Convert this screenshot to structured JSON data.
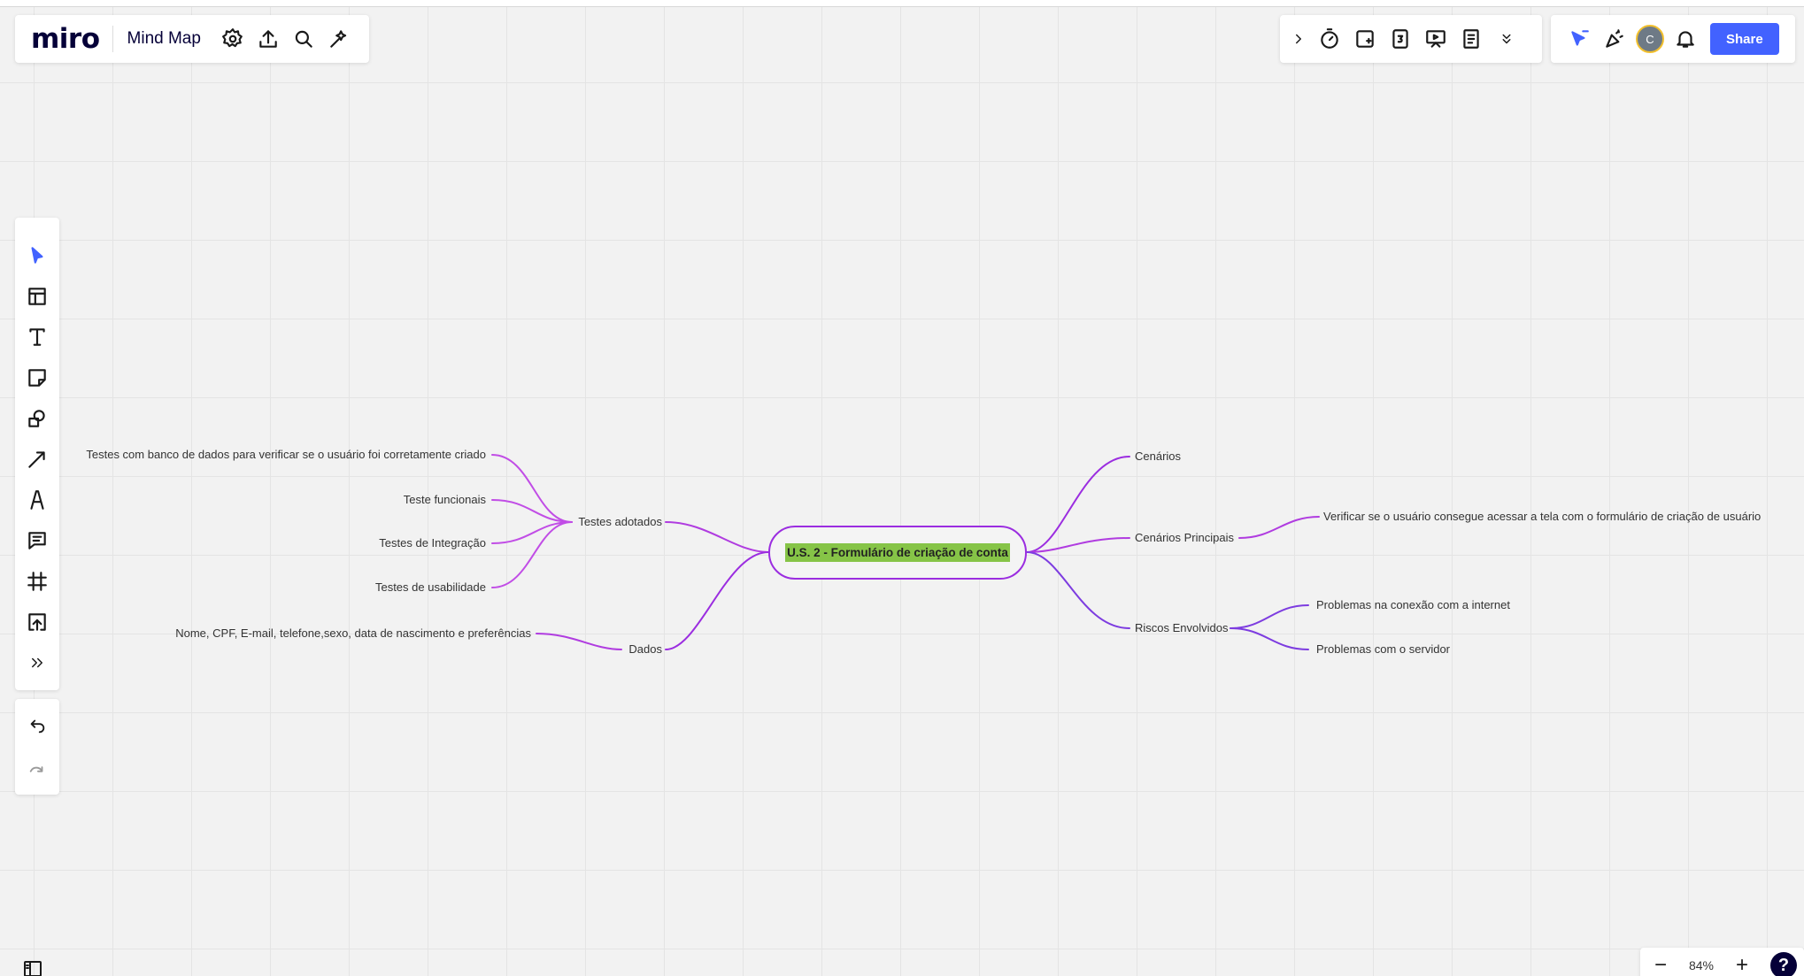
{
  "app": {
    "logo": "miro",
    "board_name": "Mind Map"
  },
  "header_right": {
    "share_label": "Share",
    "avatar_initial": "C"
  },
  "zoom": {
    "level": "84%",
    "minus": "−",
    "plus": "+",
    "help": "?"
  },
  "mind_map": {
    "root": "U.S. 2 - Formulário de criação de conta",
    "left": {
      "testes_adotados": {
        "label": "Testes adotados",
        "children": [
          "Testes com banco de dados para verificar se o usuário foi corretamente criado",
          "Teste funcionais",
          "Testes de Integração",
          "Testes de usabilidade"
        ]
      },
      "dados": {
        "label": "Dados",
        "children": [
          "Nome, CPF, E-mail, telefone,sexo, data de nascimento e preferências"
        ]
      }
    },
    "right": {
      "cenarios": {
        "label": "Cenários"
      },
      "cenarios_principais": {
        "label": "Cenários Principais",
        "children": [
          "Verificar se o usuário consegue acessar a tela com o formulário de criação de usuário"
        ]
      },
      "riscos": {
        "label": "Riscos Envolvidos",
        "children": [
          "Problemas na conexão com a internet",
          "Problemas com o servidor"
        ]
      }
    }
  },
  "colors": {
    "accent": "#4262ff",
    "branch": "#9b2de0",
    "branch_light": "#c14de6",
    "highlight": "#86c447"
  },
  "icons": {
    "top_left": [
      "settings-icon",
      "upload-icon",
      "search-icon",
      "magic-icon"
    ],
    "top_right_tools": [
      "chevron-right-icon",
      "timer-icon",
      "sticky-add-icon",
      "counter-icon",
      "presentation-icon",
      "notes-icon",
      "double-chevron-down-icon"
    ],
    "collab": [
      "cursor-flag-icon",
      "celebrate-icon",
      "bell-icon"
    ],
    "left_tools": [
      "select-icon",
      "templates-icon",
      "text-icon",
      "sticky-note-icon",
      "shapes-icon",
      "connection-line-icon",
      "pen-icon",
      "comment-icon",
      "frame-icon",
      "upload-icon",
      "more-tools-icon"
    ],
    "undo": [
      "undo-icon",
      "redo-icon"
    ]
  }
}
